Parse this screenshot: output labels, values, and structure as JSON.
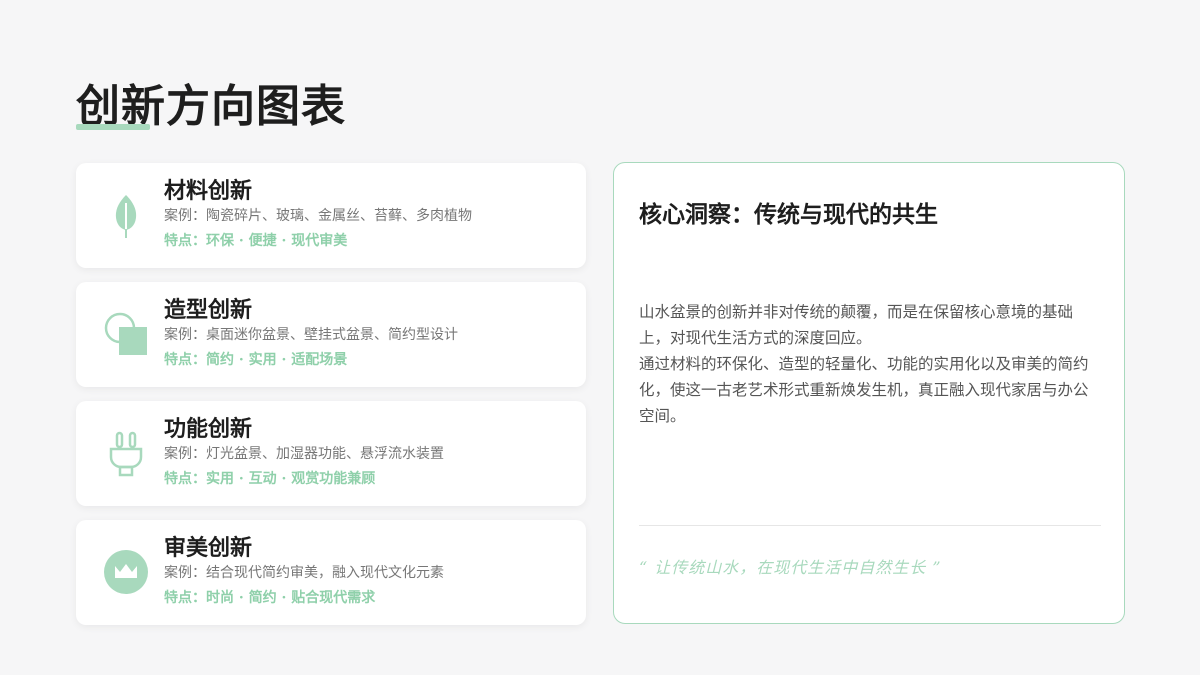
{
  "page": {
    "title": "创新方向图表",
    "accent_color": "#a8d9bd",
    "feature_color": "#8fd0aa"
  },
  "cards": [
    {
      "icon": "leaf-icon",
      "title": "材料创新",
      "case": "案例：陶瓷碎片、玻璃、金属丝、苔藓、多肉植物",
      "feature": "特点：环保 · 便捷 · 现代审美"
    },
    {
      "icon": "shapes-icon",
      "title": "造型创新",
      "case": "案例：桌面迷你盆景、壁挂式盆景、简约型设计",
      "feature": "特点：简约 · 实用 · 适配场景"
    },
    {
      "icon": "plug-icon",
      "title": "功能创新",
      "case": "案例：灯光盆景、加湿器功能、悬浮流水装置",
      "feature": "特点：实用 · 互动 · 观赏功能兼顾"
    },
    {
      "icon": "crown-icon",
      "title": "审美创新",
      "case": "案例：结合现代简约审美，融入现代文化元素",
      "feature": "特点：时尚 · 简约 · 贴合现代需求"
    }
  ],
  "insight": {
    "title": "核心洞察：传统与现代的共生",
    "paragraphs": [
      "山水盆景的创新并非对传统的颠覆，而是在保留核心意境的基础上，对现代生活方式的深度回应。",
      "通过材料的环保化、造型的轻量化、功能的实用化以及审美的简约化，使这一古老艺术形式重新焕发生机，真正融入现代家居与办公空间。"
    ],
    "quote": "“ 让传统山水，在现代生活中自然生长 ”"
  }
}
